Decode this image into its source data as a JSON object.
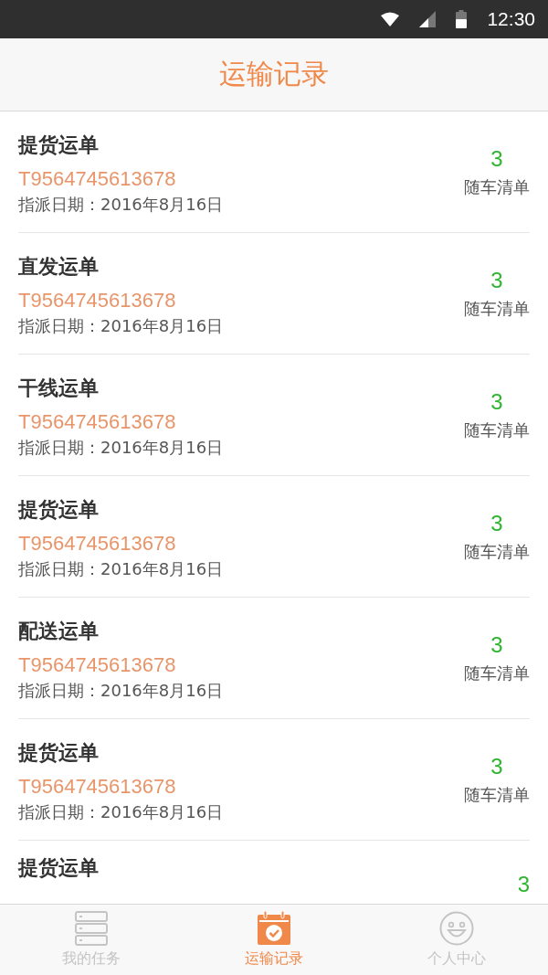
{
  "status_bar": {
    "time": "12:30"
  },
  "header": {
    "title": "运输记录"
  },
  "orders": [
    {
      "type": "提货运单",
      "number": "T9564745613678",
      "date": "指派日期：2016年8月16日",
      "count": "3",
      "count_label": "随车清单"
    },
    {
      "type": "直发运单",
      "number": "T9564745613678",
      "date": "指派日期：2016年8月16日",
      "count": "3",
      "count_label": "随车清单"
    },
    {
      "type": "干线运单",
      "number": "T9564745613678",
      "date": "指派日期：2016年8月16日",
      "count": "3",
      "count_label": "随车清单"
    },
    {
      "type": "提货运单",
      "number": "T9564745613678",
      "date": "指派日期：2016年8月16日",
      "count": "3",
      "count_label": "随车清单"
    },
    {
      "type": "配送运单",
      "number": "T9564745613678",
      "date": "指派日期：2016年8月16日",
      "count": "3",
      "count_label": "随车清单"
    },
    {
      "type": "提货运单",
      "number": "T9564745613678",
      "date": "指派日期：2016年8月16日",
      "count": "3",
      "count_label": "随车清单"
    },
    {
      "type": "提货运单",
      "count": "3"
    }
  ],
  "tab_bar": [
    {
      "label": "我的任务",
      "selected": false
    },
    {
      "label": "运输记录",
      "selected": true
    },
    {
      "label": "个人中心",
      "selected": false
    }
  ]
}
